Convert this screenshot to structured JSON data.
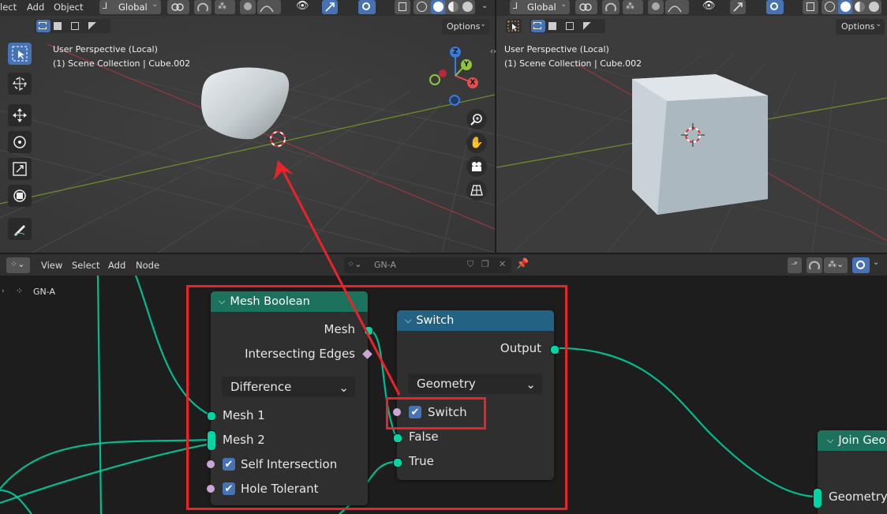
{
  "top_header": {
    "left_menu": [
      "lect",
      "Add",
      "Object"
    ],
    "transform_orientation": "Global",
    "right_orientation": "Global"
  },
  "viewport_left": {
    "options_label": "Options",
    "perspective": "User Perspective (Local)",
    "collection": "(1) Scene Collection | Cube.002",
    "gizmo_axes": {
      "x": "X",
      "y": "Y",
      "z": "Z"
    }
  },
  "viewport_right": {
    "options_label": "Options",
    "perspective": "User Perspective (Local)",
    "collection": "(1) Scene Collection | Cube.002"
  },
  "node_editor": {
    "menu": [
      "View",
      "Select",
      "Add",
      "Node"
    ],
    "nodetree_name": "GN-A",
    "breadcrumb": "GN-A"
  },
  "nodes": {
    "mesh_boolean": {
      "title": "Mesh Boolean",
      "outputs": [
        "Mesh",
        "Intersecting Edges"
      ],
      "operation": "Difference",
      "inputs": [
        "Mesh 1",
        "Mesh 2"
      ],
      "self_intersection": {
        "label": "Self Intersection",
        "checked": true
      },
      "hole_tolerant": {
        "label": "Hole Tolerant",
        "checked": true
      }
    },
    "switch": {
      "title": "Switch",
      "output": "Output",
      "type": "Geometry",
      "switch_input": {
        "label": "Switch",
        "checked": true
      },
      "false_label": "False",
      "true_label": "True"
    },
    "join_geometry": {
      "title": "Join Geo",
      "input": "Geometry"
    }
  },
  "colors": {
    "geometry_socket": "#00d6a3",
    "boolean_socket": "#cca6d6",
    "geometry_header": "#1d725e",
    "switch_header": "#246283",
    "annotation_red": "#e8232a",
    "checkbox_blue": "#4772b3"
  }
}
